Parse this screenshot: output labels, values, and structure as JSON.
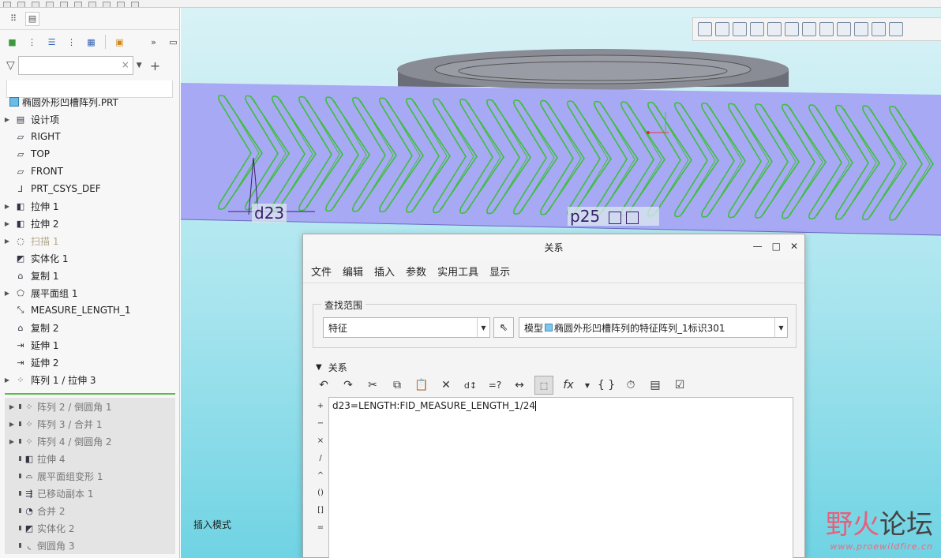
{
  "tree": {
    "root": "椭圆外形凹槽阵列.PRT",
    "items": [
      {
        "label": "设计项",
        "icon": "layers-icon",
        "expandable": true
      },
      {
        "label": "RIGHT",
        "icon": "datum-plane-icon",
        "expandable": false
      },
      {
        "label": "TOP",
        "icon": "datum-plane-icon",
        "expandable": false
      },
      {
        "label": "FRONT",
        "icon": "datum-plane-icon",
        "expandable": false
      },
      {
        "label": "PRT_CSYS_DEF",
        "icon": "csys-icon",
        "expandable": false
      },
      {
        "label": "拉伸 1",
        "icon": "extrude-icon",
        "expandable": true
      },
      {
        "label": "拉伸 2",
        "icon": "extrude-icon",
        "expandable": true
      },
      {
        "label": "扫描 1",
        "icon": "sweep-icon",
        "expandable": true,
        "dim": true
      },
      {
        "label": "实体化 1",
        "icon": "solidify-icon",
        "expandable": false
      },
      {
        "label": "复制 1",
        "icon": "copy-icon",
        "expandable": false
      },
      {
        "label": "展平面组 1",
        "icon": "flatten-quilt-icon",
        "expandable": true
      },
      {
        "label": "MEASURE_LENGTH_1",
        "icon": "measure-icon",
        "expandable": false
      },
      {
        "label": "复制 2",
        "icon": "copy-icon",
        "expandable": false
      },
      {
        "label": "延伸 1",
        "icon": "extend-icon",
        "expandable": false
      },
      {
        "label": "延伸 2",
        "icon": "extend-icon",
        "expandable": false
      },
      {
        "label": "阵列 1 / 拉伸 3",
        "icon": "pattern-icon",
        "expandable": true
      }
    ],
    "after_insert": [
      {
        "label": "阵列 2 / 倒圆角 1",
        "icon": "pattern-icon",
        "expandable": true
      },
      {
        "label": "阵列 3 / 合并 1",
        "icon": "pattern-icon",
        "expandable": true
      },
      {
        "label": "阵列 4 / 倒圆角 2",
        "icon": "pattern-icon",
        "expandable": true
      },
      {
        "label": "拉伸 4",
        "icon": "extrude-icon",
        "expandable": false
      },
      {
        "label": "展平面组变形 1",
        "icon": "flatten-deform-icon",
        "expandable": false
      },
      {
        "label": "已移动副本 1",
        "icon": "moved-copy-icon",
        "expandable": false
      },
      {
        "label": "合并 2",
        "icon": "merge-icon",
        "expandable": false
      },
      {
        "label": "实体化 2",
        "icon": "solidify-icon",
        "expandable": false
      },
      {
        "label": "倒圆角 3",
        "icon": "round-icon",
        "expandable": false
      }
    ]
  },
  "viewport": {
    "mode_label": "插入模式",
    "dim_d23": "d23",
    "dim_p25": "p25",
    "watermark_line1a": "野火",
    "watermark_line1b": "论坛",
    "watermark_line2": "www.proewildfire.cn"
  },
  "dialog": {
    "title": "关系",
    "menu": [
      "文件",
      "编辑",
      "插入",
      "参数",
      "实用工具",
      "显示"
    ],
    "scope_legend": "查找范围",
    "scope_type": "特征",
    "model_prefix": "模型",
    "model_value": "椭圆外形凹槽阵列的特征阵列_1标识301",
    "relations_label": "关系",
    "operators": [
      "+",
      "−",
      "×",
      "/",
      "^",
      "()",
      "[]",
      "="
    ],
    "relation_text": "d23=LENGTH:FID_MEASURE_LENGTH_1/24"
  },
  "colors": {
    "part_band": "#a8a9f4",
    "groove": "#3cbf3a",
    "arrow": "#e23a3a",
    "dialog_bg": "#f4f4f4"
  }
}
